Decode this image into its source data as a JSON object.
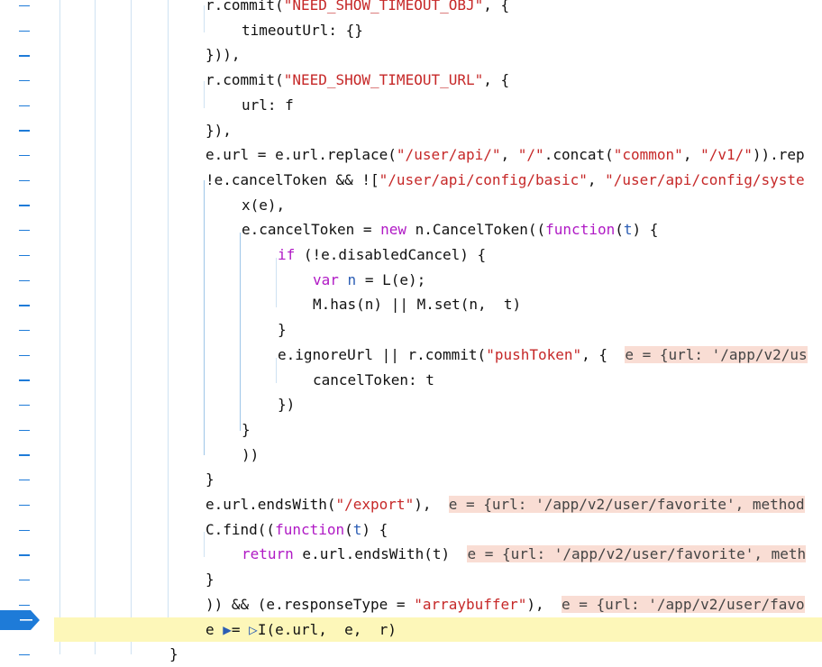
{
  "breakpoint_icon": "breakpoint-arrow-icon",
  "accent": "#1e7bd8",
  "highlight_line_color": "#fdf7b9",
  "inline_value_color": "#f9ddd4",
  "lines": [
    {
      "segments": [
        {
          "t": "r.commit(",
          "c": "p"
        },
        {
          "t": "\"NEED_SHOW_TIMEOUT_OBJ\"",
          "c": "s"
        },
        {
          "t": ", {",
          "c": "p"
        }
      ],
      "indent": 228
    },
    {
      "segments": [
        {
          "t": "timeoutUrl: {}",
          "c": "p"
        }
      ],
      "indent": 268
    },
    {
      "segments": [
        {
          "t": "})),",
          "c": "p"
        }
      ],
      "indent": 228
    },
    {
      "segments": [
        {
          "t": "r.commit(",
          "c": "p"
        },
        {
          "t": "\"NEED_SHOW_TIMEOUT_URL\"",
          "c": "s"
        },
        {
          "t": ", {",
          "c": "p"
        }
      ],
      "indent": 228
    },
    {
      "segments": [
        {
          "t": "url: f",
          "c": "p"
        }
      ],
      "indent": 268
    },
    {
      "segments": [
        {
          "t": "}),",
          "c": "p"
        }
      ],
      "indent": 228
    },
    {
      "segments": [
        {
          "t": "e.url = e.url.replace(",
          "c": "p"
        },
        {
          "t": "\"/user/api/\"",
          "c": "s"
        },
        {
          "t": ", ",
          "c": "p"
        },
        {
          "t": "\"/\"",
          "c": "s"
        },
        {
          "t": ".concat(",
          "c": "p"
        },
        {
          "t": "\"common\"",
          "c": "s"
        },
        {
          "t": ", ",
          "c": "p"
        },
        {
          "t": "\"/v1/\"",
          "c": "s"
        },
        {
          "t": ")).rep",
          "c": "p"
        }
      ],
      "indent": 228
    },
    {
      "segments": [
        {
          "t": "!e.cancelToken && ![",
          "c": "p"
        },
        {
          "t": "\"/user/api/config/basic\"",
          "c": "s"
        },
        {
          "t": ", ",
          "c": "p"
        },
        {
          "t": "\"/user/api/config/syste",
          "c": "s"
        }
      ],
      "indent": 228
    },
    {
      "segments": [
        {
          "t": "x(e),",
          "c": "p"
        }
      ],
      "indent": 268
    },
    {
      "segments": [
        {
          "t": "e.cancelToken = ",
          "c": "p"
        },
        {
          "t": "new",
          "c": "k"
        },
        {
          "t": " n.CancelToken((",
          "c": "p"
        },
        {
          "t": "function",
          "c": "k"
        },
        {
          "t": "(",
          "c": "p"
        },
        {
          "t": "t",
          "c": "v"
        },
        {
          "t": ") {",
          "c": "p"
        }
      ],
      "indent": 268
    },
    {
      "segments": [
        {
          "t": "if",
          "c": "k"
        },
        {
          "t": " (!e.disabledCancel) {",
          "c": "p"
        }
      ],
      "indent": 308
    },
    {
      "segments": [
        {
          "t": "var",
          "c": "k"
        },
        {
          "t": " ",
          "c": "p"
        },
        {
          "t": "n",
          "c": "v"
        },
        {
          "t": " = L(e);",
          "c": "p"
        }
      ],
      "indent": 347
    },
    {
      "segments": [
        {
          "t": "M.has(n) || M.set(n,  t)",
          "c": "p"
        }
      ],
      "indent": 347
    },
    {
      "segments": [
        {
          "t": "}",
          "c": "p"
        }
      ],
      "indent": 308
    },
    {
      "segments": [
        {
          "t": "e.ignoreUrl || r.commit(",
          "c": "p"
        },
        {
          "t": "\"pushToken\"",
          "c": "s"
        },
        {
          "t": ", {  ",
          "c": "p"
        },
        {
          "t": "e = {url: '/app/v2/us",
          "c": "inl"
        }
      ],
      "indent": 308
    },
    {
      "segments": [
        {
          "t": "cancelToken: t",
          "c": "p"
        }
      ],
      "indent": 347
    },
    {
      "segments": [
        {
          "t": "})",
          "c": "p"
        }
      ],
      "indent": 308
    },
    {
      "segments": [
        {
          "t": "}",
          "c": "p"
        }
      ],
      "indent": 268
    },
    {
      "segments": [
        {
          "t": "))",
          "c": "p"
        }
      ],
      "indent": 268
    },
    {
      "segments": [
        {
          "t": "}",
          "c": "p"
        }
      ],
      "indent": 228
    },
    {
      "segments": [
        {
          "t": "e.url.endsWith(",
          "c": "p"
        },
        {
          "t": "\"/export\"",
          "c": "s"
        },
        {
          "t": "),  ",
          "c": "p"
        },
        {
          "t": "e = {url: '/app/v2/user/favorite', method",
          "c": "inl"
        }
      ],
      "indent": 228
    },
    {
      "segments": [
        {
          "t": "C.find((",
          "c": "p"
        },
        {
          "t": "function",
          "c": "k"
        },
        {
          "t": "(",
          "c": "p"
        },
        {
          "t": "t",
          "c": "v"
        },
        {
          "t": ") {",
          "c": "p"
        }
      ],
      "indent": 228
    },
    {
      "segments": [
        {
          "t": "return",
          "c": "k"
        },
        {
          "t": " e.url.endsWith(t)  ",
          "c": "p"
        },
        {
          "t": "e = {url: '/app/v2/user/favorite', meth",
          "c": "inl"
        }
      ],
      "indent": 268
    },
    {
      "segments": [
        {
          "t": "}",
          "c": "p"
        }
      ],
      "indent": 228
    },
    {
      "segments": [
        {
          "t": ")) && (e.responseType = ",
          "c": "p"
        },
        {
          "t": "\"arraybuffer\"",
          "c": "s"
        },
        {
          "t": "),  ",
          "c": "p"
        },
        {
          "t": "e = {url: '/app/v2/user/favo",
          "c": "inl"
        }
      ],
      "indent": 228
    },
    {
      "segments": [
        {
          "t": "e ",
          "c": "p"
        },
        {
          "t": "▶",
          "c": "v"
        },
        {
          "t": "= ",
          "c": "p"
        },
        {
          "t": "▷",
          "c": "v"
        },
        {
          "t": "I(e.url,  e,  r)",
          "c": "p"
        }
      ],
      "indent": 228,
      "current": true
    },
    {
      "segments": [
        {
          "t": "}",
          "c": "p"
        }
      ],
      "indent": 188
    }
  ]
}
